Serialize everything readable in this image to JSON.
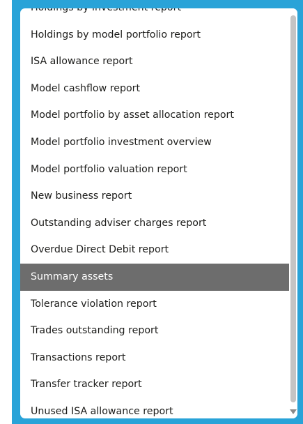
{
  "dropdown": {
    "items": [
      "Holdings by investment report",
      "Holdings by model portfolio report",
      "ISA allowance report",
      "Model cashflow report",
      "Model portfolio by asset allocation report",
      "Model portfolio investment overview",
      "Model portfolio valuation report",
      "New business report",
      "Outstanding adviser charges report",
      "Overdue Direct Debit report",
      "Summary assets",
      "Tolerance violation report",
      "Trades outstanding report",
      "Transactions report",
      "Transfer tracker report",
      "Unused ISA allowance report"
    ],
    "selected": "Summary assets",
    "scroll_position": 0.95
  },
  "colors": {
    "frame": "#29a3d8",
    "highlight": "#6d6d6d",
    "scroll_thumb": "#c4c4c4"
  }
}
